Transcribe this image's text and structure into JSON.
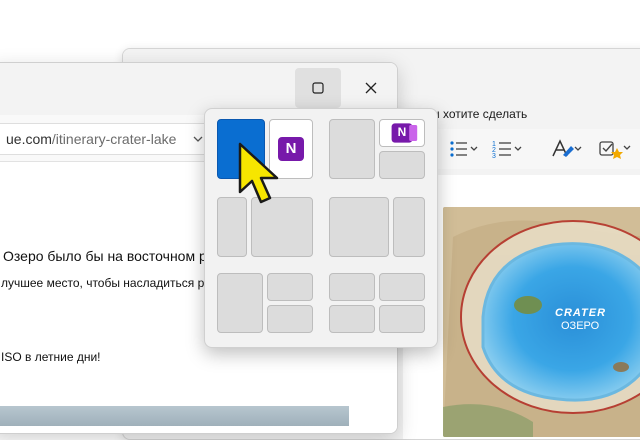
{
  "back_window": {
    "hint_text": "что вы хотите сделать",
    "map": {
      "label_crater": "CRATER",
      "label_lake": "ОЗЕРО"
    },
    "toolbar": [
      "bullets-icon",
      "numbering-icon",
      "highlight-icon",
      "todo-icon"
    ]
  },
  "front_window": {
    "url_domain": "ue.com",
    "url_path": "/itinerary-crater-lake",
    "paragraph_1": "Озеро было бы на восточном ребро",
    "paragraph_2": "лучшее место, чтобы насладиться рев,",
    "paragraph_3": "ISO в летние дни!"
  },
  "snap_layouts": {
    "app_label": "N",
    "accent_color": "#0a6ed1"
  }
}
